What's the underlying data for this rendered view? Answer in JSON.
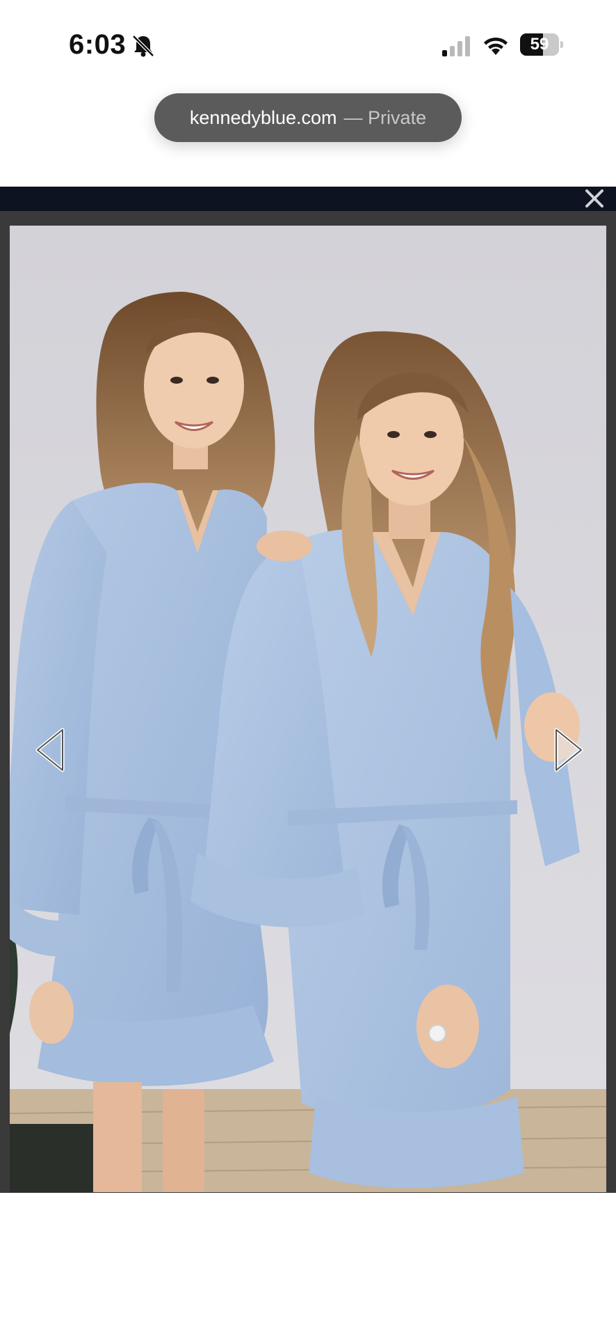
{
  "status_bar": {
    "time": "6:03",
    "battery": "59",
    "battery_level": 0.59,
    "icons": [
      "bell-slash-icon",
      "cellular-signal-icon",
      "wifi-icon",
      "battery-icon"
    ]
  },
  "browser": {
    "domain": "kennedyblue.com",
    "mode": "— Private"
  },
  "lightbox": {
    "close_icon": "close-icon",
    "prev_icon": "chevron-left-icon",
    "next_icon": "chevron-right-icon"
  },
  "colors": {
    "robe": "#a8c0df",
    "topbar": "#0d1321",
    "frame": "#3a3a3a",
    "pill": "#5b5b5b"
  }
}
